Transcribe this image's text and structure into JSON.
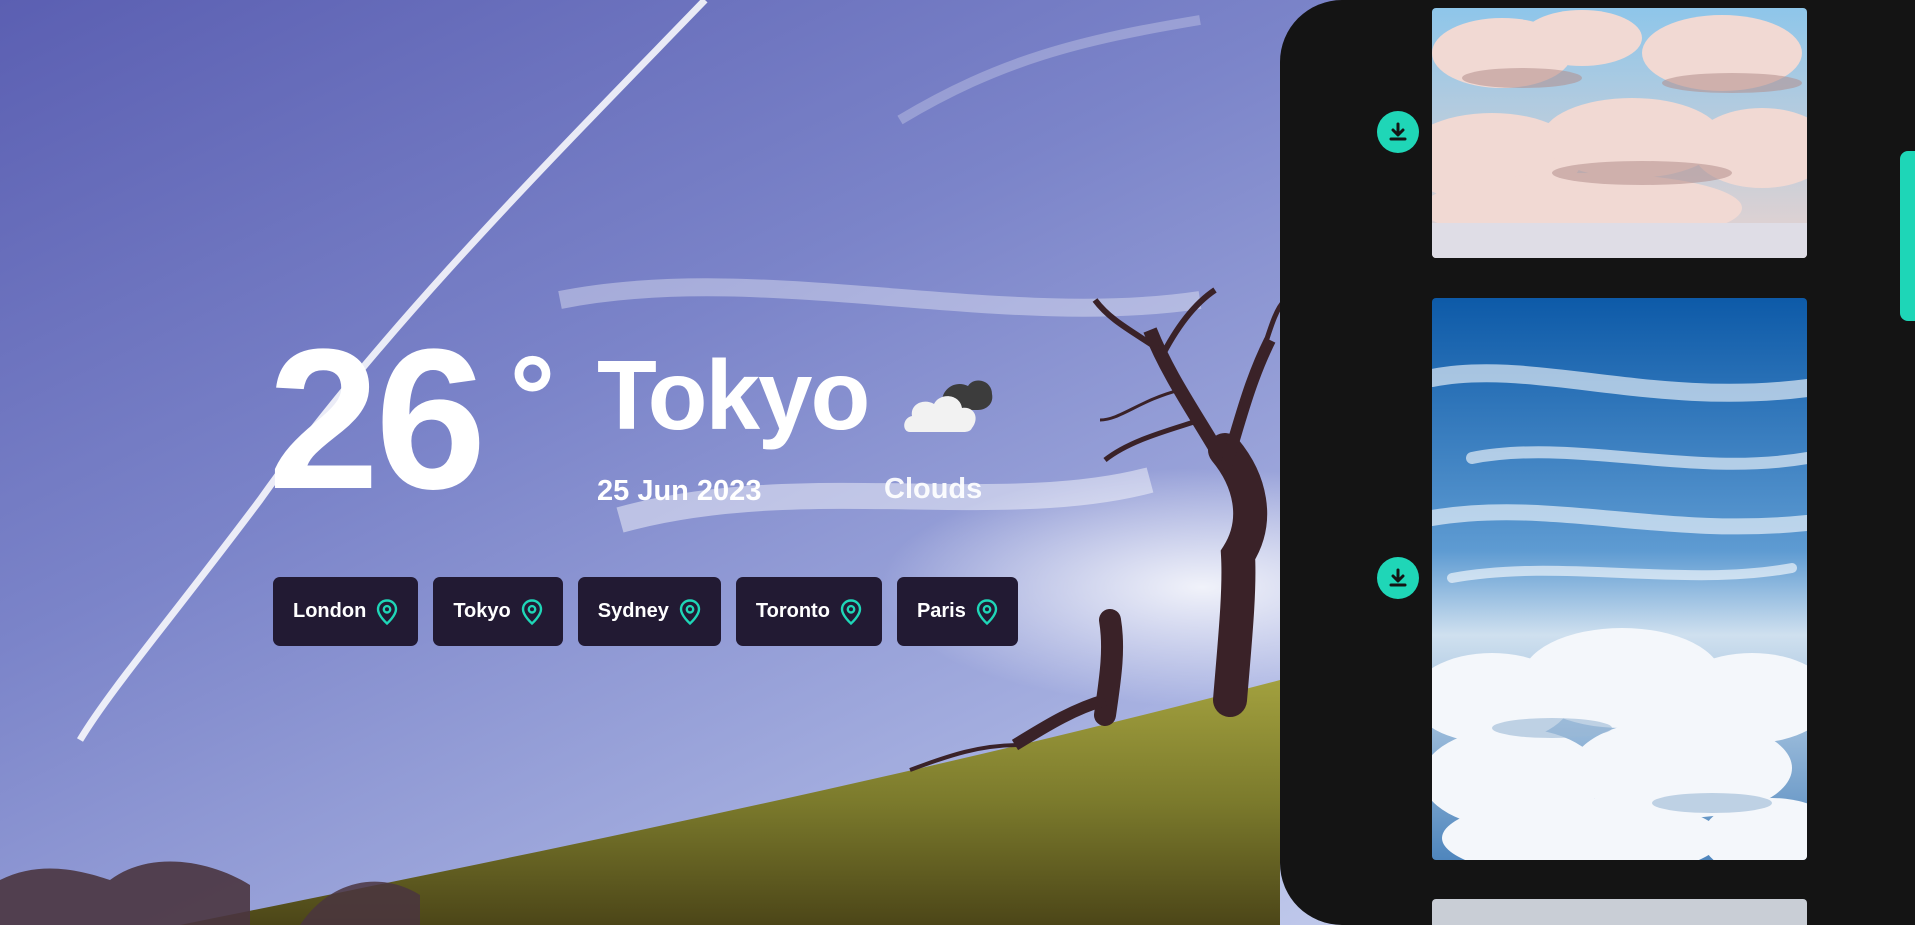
{
  "weather": {
    "temperature": "26",
    "degree_symbol": "°",
    "city": "Tokyo",
    "date": "25 Jun 2023",
    "condition": "Clouds",
    "condition_icon": "cloud-icon"
  },
  "city_chips": [
    {
      "label": "London",
      "icon": "map-pin-icon"
    },
    {
      "label": "Tokyo",
      "icon": "map-pin-icon"
    },
    {
      "label": "Sydney",
      "icon": "map-pin-icon"
    },
    {
      "label": "Toronto",
      "icon": "map-pin-icon"
    },
    {
      "label": "Paris",
      "icon": "map-pin-icon"
    }
  ],
  "gallery": {
    "download_icon": "download-icon",
    "images": [
      {
        "subject": "puffy clouds at sunset"
      },
      {
        "subject": "blue sky above clouds"
      },
      {
        "subject": "cloudy sky"
      }
    ]
  },
  "colors": {
    "accent": "#1fd6b7",
    "chip_bg": "#221a33",
    "panel_bg": "#141414",
    "text": "#ffffff"
  }
}
